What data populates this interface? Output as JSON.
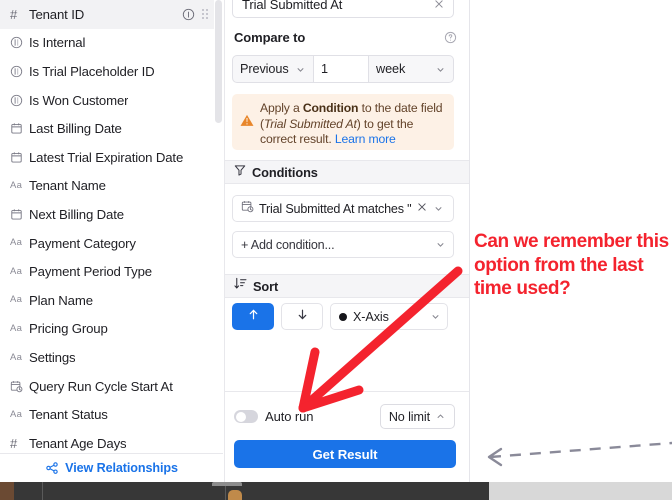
{
  "fields_panel": {
    "items": [
      {
        "icon": "hash-icon",
        "label": "Tenant ID",
        "selected": true,
        "has_info": true
      },
      {
        "icon": "boolean-icon",
        "label": "Is Internal",
        "selected": false,
        "has_info": false
      },
      {
        "icon": "boolean-icon",
        "label": "Is Trial Placeholder ID",
        "selected": false,
        "has_info": false
      },
      {
        "icon": "boolean-icon",
        "label": "Is Won Customer",
        "selected": false,
        "has_info": false
      },
      {
        "icon": "calendar-icon",
        "label": "Last Billing Date",
        "selected": false,
        "has_info": false
      },
      {
        "icon": "calendar-icon",
        "label": "Latest Trial Expiration Date",
        "selected": false,
        "has_info": false
      },
      {
        "icon": "text-icon",
        "label": "Tenant Name",
        "selected": false,
        "has_info": false
      },
      {
        "icon": "calendar-icon",
        "label": "Next Billing Date",
        "selected": false,
        "has_info": false
      },
      {
        "icon": "text-icon",
        "label": "Payment Category",
        "selected": false,
        "has_info": false
      },
      {
        "icon": "text-icon",
        "label": "Payment Period Type",
        "selected": false,
        "has_info": false
      },
      {
        "icon": "text-icon",
        "label": "Plan Name",
        "selected": false,
        "has_info": false
      },
      {
        "icon": "text-icon",
        "label": "Pricing Group",
        "selected": false,
        "has_info": false
      },
      {
        "icon": "text-icon",
        "label": "Settings",
        "selected": false,
        "has_info": false
      },
      {
        "icon": "datetime-icon",
        "label": "Query Run Cycle Start At",
        "selected": false,
        "has_info": false
      },
      {
        "icon": "text-icon",
        "label": "Tenant Status",
        "selected": false,
        "has_info": false
      },
      {
        "icon": "hash-icon",
        "label": "Tenant Age Days",
        "selected": false,
        "has_info": false
      }
    ],
    "footer": {
      "icon": "relationships-icon",
      "label": "View Relationships"
    }
  },
  "config_panel": {
    "selected_field": {
      "value": "Trial Submitted At",
      "clear_icon": "close-icon"
    },
    "compare_to": {
      "title": "Compare to",
      "help_icon": "question-circle-icon",
      "direction": "Previous",
      "amount": "1",
      "unit": "week"
    },
    "warning": {
      "icon": "warning-triangle-icon",
      "text_part1": "Apply a ",
      "bold": "Condition",
      "text_part2": " to the date field (",
      "italic": "Trial Submitted At",
      "text_part3": ") to get the correct result. ",
      "link": "Learn more"
    },
    "conditions": {
      "title": "Conditions",
      "icon": "filter-icon",
      "chip": {
        "icon": "datetime-icon",
        "label": "Trial Submitted At matches \"",
        "remove_icon": "close-icon",
        "expand_icon": "chevron-down-icon"
      },
      "add": {
        "label": "+ Add condition...",
        "expand_icon": "chevron-down-icon"
      }
    },
    "sort": {
      "title": "Sort",
      "icon": "sort-icon",
      "asc_icon": "arrow-up-icon",
      "desc_icon": "arrow-down-icon",
      "field": "X-Axis",
      "field_expand_icon": "chevron-down-icon"
    },
    "footer": {
      "auto_run_label": "Auto run",
      "auto_run_on": false,
      "limit_label": "No limit",
      "limit_icon": "chevron-up-icon",
      "get_result_label": "Get Result"
    }
  },
  "annotations": {
    "note_text": "Can we remember this option from the last time used?",
    "note_color": "#f4232e",
    "arrow_color": "#f4232e",
    "dashed_arrow_color": "#8a8a99"
  }
}
